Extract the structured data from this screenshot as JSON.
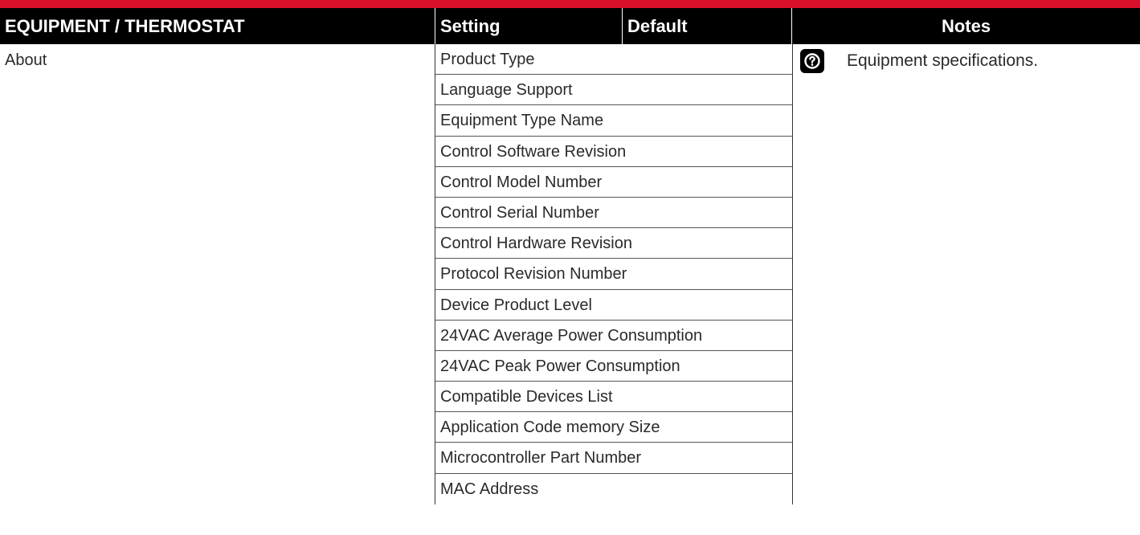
{
  "header": {
    "equipment": "EQUIPMENT / THERMOSTAT",
    "setting": "Setting",
    "default": "Default",
    "notes": "Notes"
  },
  "section_label": "About",
  "settings": [
    "Product Type",
    "Language Support",
    "Equipment Type Name",
    "Control Software Revision",
    "Control Model Number",
    "Control Serial Number",
    "Control Hardware Revision",
    "Protocol Revision Number",
    "Device Product Level",
    "24VAC Average Power Consumption",
    "24VAC Peak Power Consumption",
    "Compatible Devices List",
    "Application Code memory Size",
    "Microcontroller Part Number",
    "MAC Address"
  ],
  "notes": {
    "icon": "help-icon",
    "text": "Equipment specifications."
  },
  "colors": {
    "accent": "#d8102b",
    "header_bg": "#000000",
    "header_text": "#ffffff"
  }
}
